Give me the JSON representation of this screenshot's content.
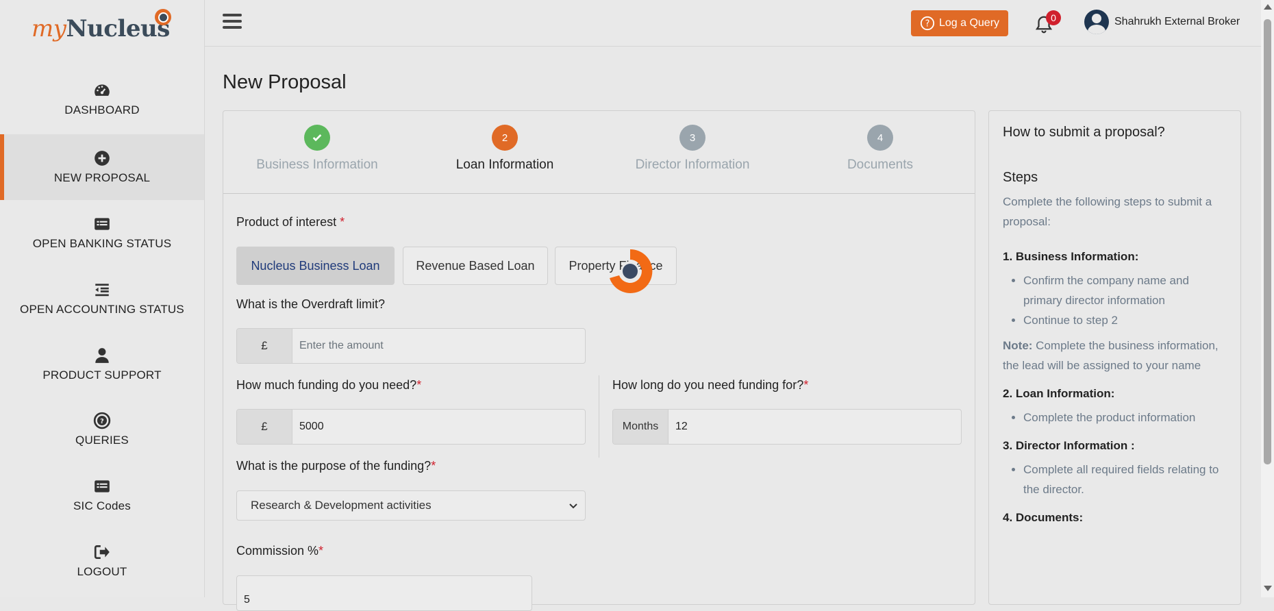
{
  "logo": {
    "my": "my",
    "nucleus": "Nucleus"
  },
  "sidebar": {
    "items": [
      {
        "label": "DASHBOARD",
        "icon": "dashboard-icon"
      },
      {
        "label": "NEW PROPOSAL",
        "icon": "plus-circle-icon"
      },
      {
        "label": "OPEN BANKING STATUS",
        "icon": "list-card-icon"
      },
      {
        "label": "OPEN ACCOUNTING STATUS",
        "icon": "indent-list-icon"
      },
      {
        "label": "PRODUCT SUPPORT",
        "icon": "user-icon"
      },
      {
        "label": "QUERIES",
        "icon": "question-circle-icon"
      },
      {
        "label": "SIC Codes",
        "icon": "list-card-icon"
      },
      {
        "label": "LOGOUT",
        "icon": "logout-icon"
      }
    ]
  },
  "topbar": {
    "query_label": "Log a Query",
    "notification_count": "0",
    "user_name": "Shahrukh External Broker"
  },
  "page": {
    "title": "New Proposal"
  },
  "stepper": {
    "steps": [
      {
        "number": "",
        "label": "Business Information",
        "state": "done"
      },
      {
        "number": "2",
        "label": "Loan Information",
        "state": "active"
      },
      {
        "number": "3",
        "label": "Director Information",
        "state": "pending"
      },
      {
        "number": "4",
        "label": "Documents",
        "state": "pending"
      }
    ]
  },
  "form": {
    "product_label": "Product of interest",
    "required_mark": "*",
    "products": [
      "Nucleus Business Loan",
      "Revenue Based Loan",
      "Property Finance"
    ],
    "selected_product": "Nucleus Business Loan",
    "overdraft_label": "What is the Overdraft limit?",
    "currency": "£",
    "overdraft_placeholder": "Enter the amount",
    "funding_label": "How much funding do you need?",
    "funding_value": "5000",
    "duration_label": "How long do you need funding for?",
    "duration_unit": "Months",
    "duration_value": "12",
    "purpose_label": "What is the purpose of the funding?",
    "purpose_value": "Research & Development activities",
    "commission_label": "Commission %",
    "commission_value": "5"
  },
  "help": {
    "title": "How to submit a proposal?",
    "steps_heading": "Steps",
    "intro": "Complete the following steps to submit a proposal:",
    "s1_title": "1. Business Information:",
    "s1_items": [
      "Confirm the company name and primary director information",
      "Continue to step 2"
    ],
    "note_label": "Note:",
    "note_text": " Complete the business information, the lead will be assigned to your name",
    "s2_title": "2. Loan Information:",
    "s2_items": [
      "Complete the product information"
    ],
    "s3_title": "3. Director Information :",
    "s3_items": [
      "Complete all required fields relating to the director."
    ],
    "s4_title": "4. Documents:"
  },
  "colors": {
    "accent": "#e06a26",
    "success": "#5cb85c",
    "pending": "#9aa5ad",
    "badge": "#d0202d",
    "spinner_core": "#3b4a63"
  }
}
